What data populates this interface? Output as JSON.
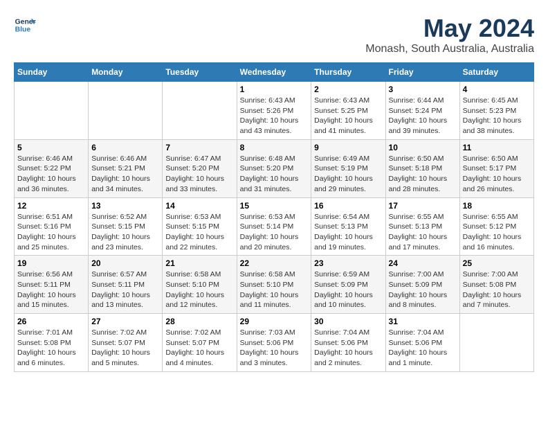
{
  "header": {
    "logo_line1": "General",
    "logo_line2": "Blue",
    "title": "May 2024",
    "subtitle": "Monash, South Australia, Australia"
  },
  "weekdays": [
    "Sunday",
    "Monday",
    "Tuesday",
    "Wednesday",
    "Thursday",
    "Friday",
    "Saturday"
  ],
  "weeks": [
    [
      {
        "day": "",
        "info": ""
      },
      {
        "day": "",
        "info": ""
      },
      {
        "day": "",
        "info": ""
      },
      {
        "day": "1",
        "info": "Sunrise: 6:43 AM\nSunset: 5:26 PM\nDaylight: 10 hours\nand 43 minutes."
      },
      {
        "day": "2",
        "info": "Sunrise: 6:43 AM\nSunset: 5:25 PM\nDaylight: 10 hours\nand 41 minutes."
      },
      {
        "day": "3",
        "info": "Sunrise: 6:44 AM\nSunset: 5:24 PM\nDaylight: 10 hours\nand 39 minutes."
      },
      {
        "day": "4",
        "info": "Sunrise: 6:45 AM\nSunset: 5:23 PM\nDaylight: 10 hours\nand 38 minutes."
      }
    ],
    [
      {
        "day": "5",
        "info": "Sunrise: 6:46 AM\nSunset: 5:22 PM\nDaylight: 10 hours\nand 36 minutes."
      },
      {
        "day": "6",
        "info": "Sunrise: 6:46 AM\nSunset: 5:21 PM\nDaylight: 10 hours\nand 34 minutes."
      },
      {
        "day": "7",
        "info": "Sunrise: 6:47 AM\nSunset: 5:20 PM\nDaylight: 10 hours\nand 33 minutes."
      },
      {
        "day": "8",
        "info": "Sunrise: 6:48 AM\nSunset: 5:20 PM\nDaylight: 10 hours\nand 31 minutes."
      },
      {
        "day": "9",
        "info": "Sunrise: 6:49 AM\nSunset: 5:19 PM\nDaylight: 10 hours\nand 29 minutes."
      },
      {
        "day": "10",
        "info": "Sunrise: 6:50 AM\nSunset: 5:18 PM\nDaylight: 10 hours\nand 28 minutes."
      },
      {
        "day": "11",
        "info": "Sunrise: 6:50 AM\nSunset: 5:17 PM\nDaylight: 10 hours\nand 26 minutes."
      }
    ],
    [
      {
        "day": "12",
        "info": "Sunrise: 6:51 AM\nSunset: 5:16 PM\nDaylight: 10 hours\nand 25 minutes."
      },
      {
        "day": "13",
        "info": "Sunrise: 6:52 AM\nSunset: 5:15 PM\nDaylight: 10 hours\nand 23 minutes."
      },
      {
        "day": "14",
        "info": "Sunrise: 6:53 AM\nSunset: 5:15 PM\nDaylight: 10 hours\nand 22 minutes."
      },
      {
        "day": "15",
        "info": "Sunrise: 6:53 AM\nSunset: 5:14 PM\nDaylight: 10 hours\nand 20 minutes."
      },
      {
        "day": "16",
        "info": "Sunrise: 6:54 AM\nSunset: 5:13 PM\nDaylight: 10 hours\nand 19 minutes."
      },
      {
        "day": "17",
        "info": "Sunrise: 6:55 AM\nSunset: 5:13 PM\nDaylight: 10 hours\nand 17 minutes."
      },
      {
        "day": "18",
        "info": "Sunrise: 6:55 AM\nSunset: 5:12 PM\nDaylight: 10 hours\nand 16 minutes."
      }
    ],
    [
      {
        "day": "19",
        "info": "Sunrise: 6:56 AM\nSunset: 5:11 PM\nDaylight: 10 hours\nand 15 minutes."
      },
      {
        "day": "20",
        "info": "Sunrise: 6:57 AM\nSunset: 5:11 PM\nDaylight: 10 hours\nand 13 minutes."
      },
      {
        "day": "21",
        "info": "Sunrise: 6:58 AM\nSunset: 5:10 PM\nDaylight: 10 hours\nand 12 minutes."
      },
      {
        "day": "22",
        "info": "Sunrise: 6:58 AM\nSunset: 5:10 PM\nDaylight: 10 hours\nand 11 minutes."
      },
      {
        "day": "23",
        "info": "Sunrise: 6:59 AM\nSunset: 5:09 PM\nDaylight: 10 hours\nand 10 minutes."
      },
      {
        "day": "24",
        "info": "Sunrise: 7:00 AM\nSunset: 5:09 PM\nDaylight: 10 hours\nand 8 minutes."
      },
      {
        "day": "25",
        "info": "Sunrise: 7:00 AM\nSunset: 5:08 PM\nDaylight: 10 hours\nand 7 minutes."
      }
    ],
    [
      {
        "day": "26",
        "info": "Sunrise: 7:01 AM\nSunset: 5:08 PM\nDaylight: 10 hours\nand 6 minutes."
      },
      {
        "day": "27",
        "info": "Sunrise: 7:02 AM\nSunset: 5:07 PM\nDaylight: 10 hours\nand 5 minutes."
      },
      {
        "day": "28",
        "info": "Sunrise: 7:02 AM\nSunset: 5:07 PM\nDaylight: 10 hours\nand 4 minutes."
      },
      {
        "day": "29",
        "info": "Sunrise: 7:03 AM\nSunset: 5:06 PM\nDaylight: 10 hours\nand 3 minutes."
      },
      {
        "day": "30",
        "info": "Sunrise: 7:04 AM\nSunset: 5:06 PM\nDaylight: 10 hours\nand 2 minutes."
      },
      {
        "day": "31",
        "info": "Sunrise: 7:04 AM\nSunset: 5:06 PM\nDaylight: 10 hours\nand 1 minute."
      },
      {
        "day": "",
        "info": ""
      }
    ]
  ]
}
